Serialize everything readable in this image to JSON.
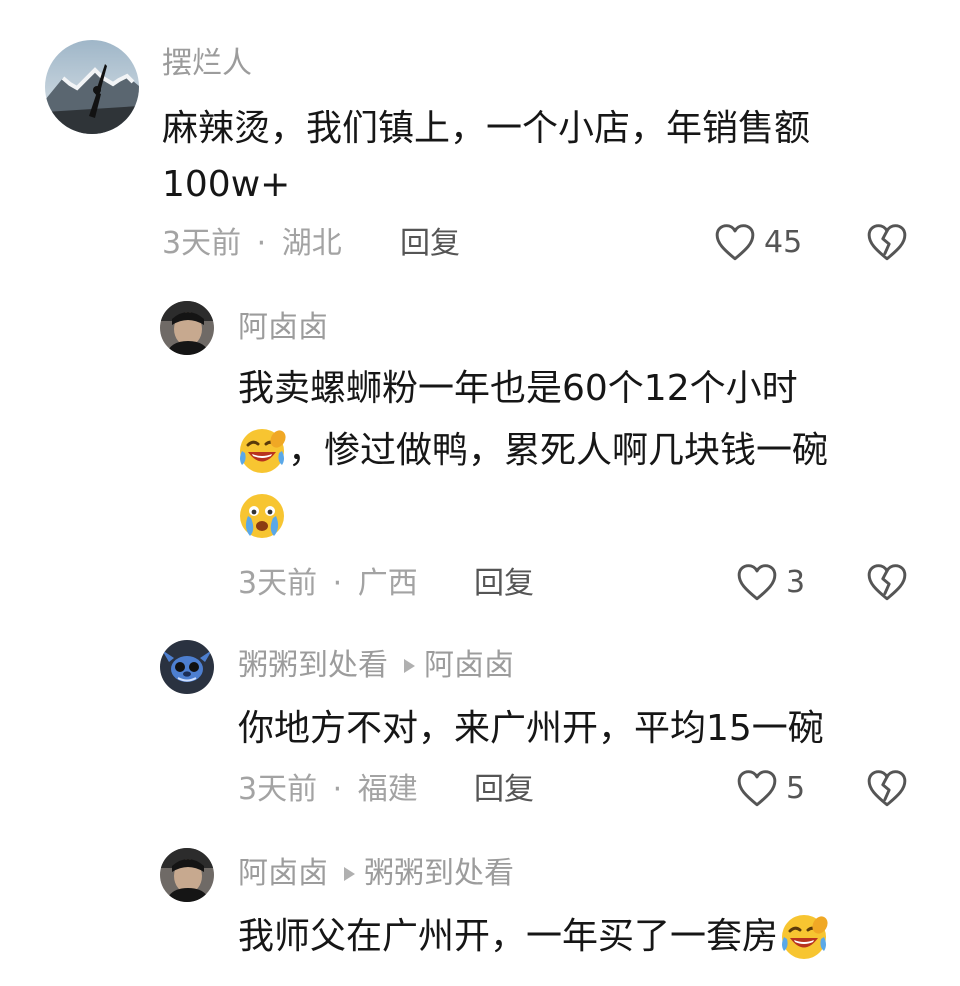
{
  "comments": [
    {
      "author": "摆烂人",
      "text_lines": [
        "麻辣烫，我们镇上，一个小店，年销售额",
        "100w+"
      ],
      "time": "3天前",
      "location": "湖北",
      "reply_label": "回复",
      "likes": "45"
    },
    {
      "author": "阿卤卤",
      "text_line1": "我卖螺蛳粉一年也是60个12个小时",
      "text_line2": "，惨过做鸭，累死人啊几块钱一碗",
      "emoji_1": "crying-laughing-emoji",
      "emoji_2": "crying-emoji",
      "time": "3天前",
      "location": "广西",
      "reply_label": "回复",
      "likes": "3"
    },
    {
      "author": "粥粥到处看",
      "reply_to": "阿卤卤",
      "text": "你地方不对，来广州开，平均15一碗",
      "time": "3天前",
      "location": "福建",
      "reply_label": "回复",
      "likes": "5"
    },
    {
      "author": "阿卤卤",
      "reply_to": "粥粥到处看",
      "text": "我师父在广州开，一年买了一套房",
      "emoji": "crying-laughing-emoji"
    }
  ],
  "separator": "·",
  "colors": {
    "text": "#161616",
    "muted": "#a3a3a3",
    "name": "#9c9c9c",
    "emoji": "#f7c531"
  }
}
